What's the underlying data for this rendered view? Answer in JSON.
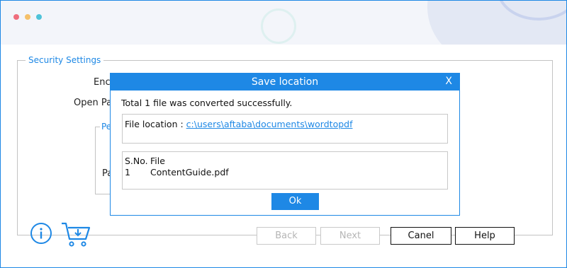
{
  "window": {
    "title_dots": [
      "#ef6d7d",
      "#f5c06a",
      "#4fc3d9"
    ]
  },
  "security_settings": {
    "legend": "Security Settings",
    "encrypt_label_partial": "Enc",
    "open_password_label_partial": "Open Pa",
    "permissions_legend_partial": "Pe",
    "password_label_partial": "Pa"
  },
  "footer": {
    "info_icon": "info-circle-icon",
    "cart_icon": "cart-download-icon",
    "back_label": "Back",
    "next_label": "Next",
    "cancel_label": "Canel",
    "help_label": "Help"
  },
  "dialog": {
    "title": "Save location",
    "close_label": "X",
    "message": "Total 1 file was converted successfully.",
    "file_location_label": "File location : ",
    "file_location_path": "c:\\users\\aftaba\\documents\\wordtopdf",
    "table": {
      "headers": [
        "S.No.",
        "File"
      ],
      "rows": [
        [
          "1",
          "ContentGuide.pdf"
        ]
      ]
    },
    "ok_label": "Ok"
  },
  "colors": {
    "accent": "#1e88e5",
    "disabled_text": "#b5b5b5"
  }
}
